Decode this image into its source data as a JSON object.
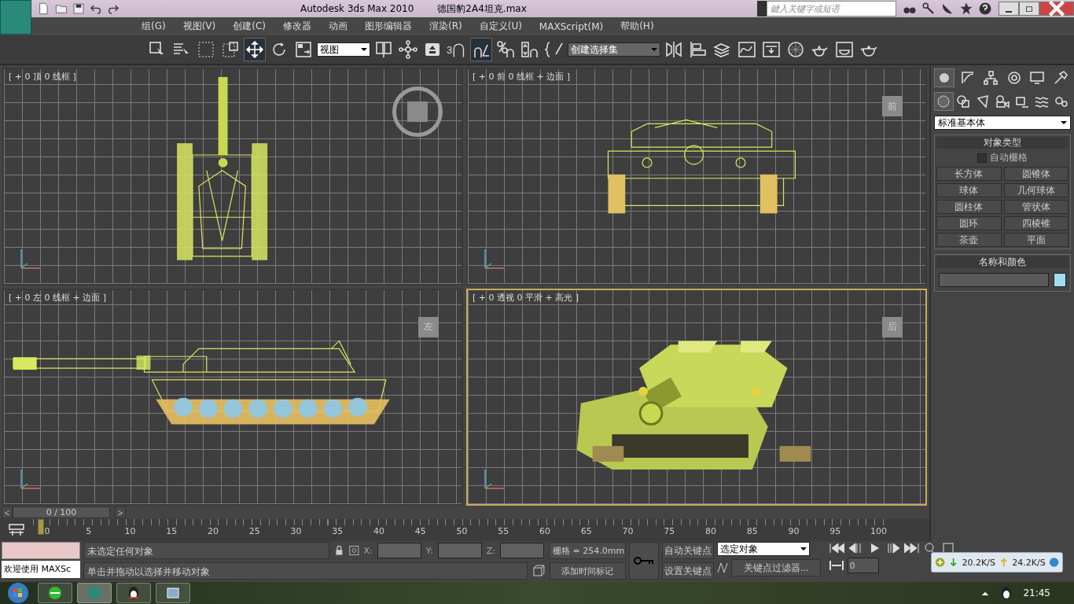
{
  "title_bar": {
    "app_title": "Autodesk 3ds Max  2010",
    "file_name": "德国豹2A4坦克.max",
    "search_placeholder": "鍵入关键字或短语"
  },
  "menu": [
    "组(G)",
    "视图(V)",
    "创建(C)",
    "修改器",
    "动画",
    "图形编辑器",
    "渲染(R)",
    "自定义(U)",
    "MAXScript(M)",
    "帮助(H)"
  ],
  "toolbar": [
    {
      "kind": "select",
      "selected": false
    },
    {
      "kind": "select-list",
      "selected": false
    },
    {
      "kind": "rect-region",
      "selected": false
    },
    {
      "kind": "window-crossing",
      "selected": false
    },
    {
      "kind": "move",
      "selected": true
    },
    {
      "kind": "rotate",
      "selected": false
    },
    {
      "kind": "scale",
      "selected": false
    },
    {
      "kind": "dropdown",
      "value": "视图"
    },
    {
      "kind": "pivot",
      "selected": false
    },
    {
      "kind": "manipulate",
      "selected": false
    },
    {
      "kind": "keyboard",
      "selected": false
    },
    {
      "kind": "snap",
      "label": "3",
      "selected": false
    },
    {
      "kind": "angle-snap",
      "selected": true
    },
    {
      "kind": "percent-snap",
      "selected": false
    },
    {
      "kind": "spinner-snap",
      "selected": false
    },
    {
      "kind": "edit-named",
      "selected": false
    },
    {
      "kind": "dropdown",
      "value": "创建选择集"
    },
    {
      "kind": "mirror",
      "selected": false
    },
    {
      "kind": "align",
      "selected": false
    },
    {
      "kind": "layers",
      "selected": false
    },
    {
      "kind": "curve-editor",
      "selected": false
    },
    {
      "kind": "schematic",
      "selected": false
    },
    {
      "kind": "material",
      "selected": false
    },
    {
      "kind": "render-setup",
      "selected": false
    },
    {
      "kind": "render-frame",
      "selected": false
    },
    {
      "kind": "teapot",
      "selected": false
    }
  ],
  "viewports": [
    {
      "kind": "top",
      "label": "[ + 0 顶 0 线框 ]",
      "selected": false
    },
    {
      "kind": "front",
      "label": "[ + 0 前 0 线框 + 边面 ]",
      "cube_label": "前",
      "selected": false
    },
    {
      "kind": "left",
      "label": "[ + 0 左 0 线框 + 边面 ]",
      "cube_label": "左",
      "selected": false
    },
    {
      "kind": "persp",
      "label": "[ + 0 透视 0 平滑 + 高光 ]",
      "cube_label": "后",
      "selected": true
    }
  ],
  "command_panel": {
    "tabs": [
      {
        "selected": true
      },
      {
        "selected": false
      },
      {
        "selected": false
      },
      {
        "selected": false
      },
      {
        "selected": false
      },
      {
        "selected": false
      }
    ],
    "categories": [
      {
        "selected": true
      },
      {
        "selected": false
      },
      {
        "selected": false
      },
      {
        "selected": false
      },
      {
        "selected": false
      },
      {
        "selected": false
      },
      {
        "selected": false
      }
    ],
    "dropdown": "标准基本体",
    "object_type": {
      "title": "对象类型",
      "autogrid": {
        "label": "自动栅格",
        "checked": false
      },
      "buttons": [
        "长方体",
        "圆锥体",
        "球体",
        "几何球体",
        "圆柱体",
        "管状体",
        "圆环",
        "四棱锥",
        "茶壶",
        "平面"
      ]
    },
    "name_color": {
      "title": "名称和颜色",
      "color": "#a0dcee"
    }
  },
  "time_slider": {
    "prev": "<",
    "position": "0 / 100",
    "next": ">",
    "level": 0
  },
  "track_ticks": [
    "0",
    "5",
    "10",
    "15",
    "20",
    "25",
    "30",
    "35",
    "40",
    "45",
    "50",
    "55",
    "60",
    "65",
    "70",
    "75",
    "80",
    "85",
    "90",
    "95",
    "100"
  ],
  "status": {
    "maxscript": "欢迎使用 MAXSc",
    "selection": "未选定任何对象",
    "prompt": "单击并拖动以选择并移动对象",
    "x_label": "X:",
    "y_label": "Y:",
    "z_label": "Z:",
    "grid": "栅格 = 254.0mm",
    "add_time_tag": "添加时间标记",
    "auto_key": "自动关键点",
    "set_key": "设置关键点",
    "key_mode": "选定对象",
    "key_filters": "关键点过滤器...",
    "frame": "0"
  },
  "net_widget": {
    "down": "20.2K/S",
    "up": "24.2K/S"
  },
  "taskbar": {
    "items": [
      {
        "selected": false
      },
      {
        "selected": true
      },
      {
        "selected": false
      },
      {
        "selected": false
      }
    ],
    "clock": "21:45"
  }
}
